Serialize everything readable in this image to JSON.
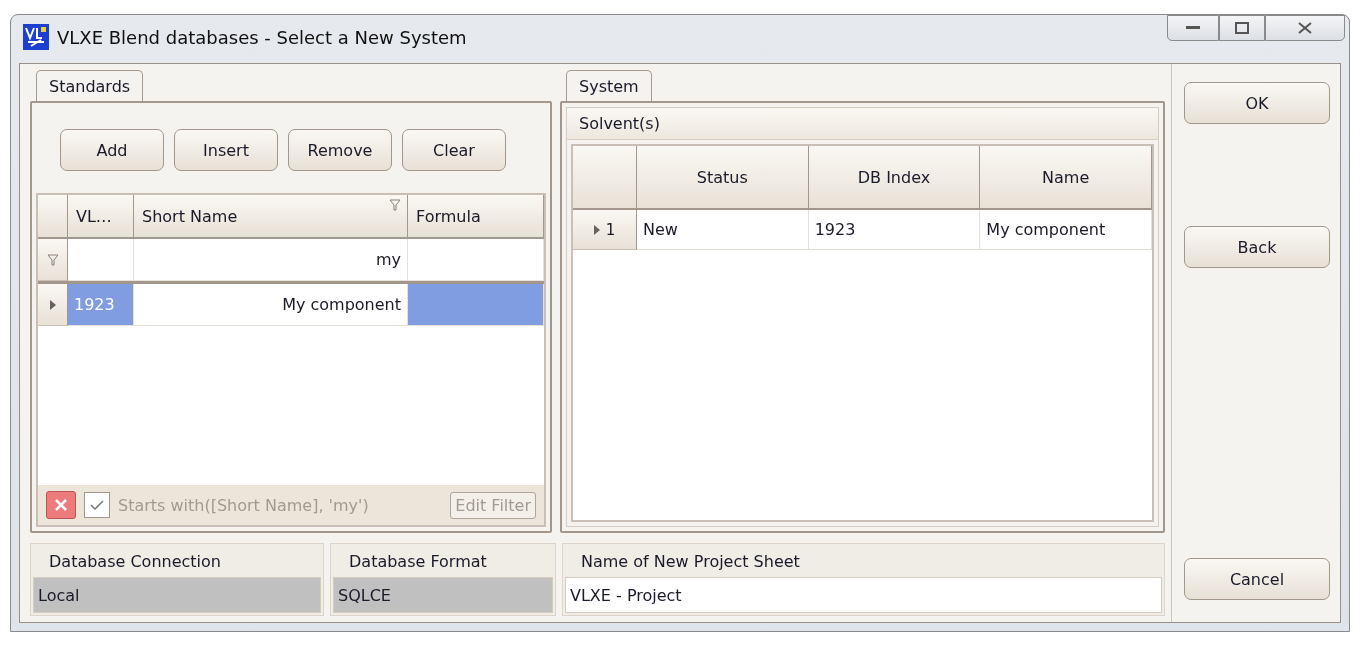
{
  "window": {
    "title": "VLXE Blend databases - Select a New System"
  },
  "standards": {
    "tab": {
      "label": "Standards",
      "selected": true
    },
    "buttons": [
      "Add",
      "Insert",
      "Remove",
      "Clear"
    ],
    "columns": [
      {
        "label": "VL…",
        "filtered": false,
        "focused": false
      },
      {
        "label": "Short Name",
        "filtered": true,
        "focused": true,
        "filter": "my"
      },
      {
        "label": "Formula",
        "filtered": false,
        "focused": false
      }
    ],
    "rows": [
      {
        "selected": true,
        "cells": [
          "1923",
          "My component"
        ]
      }
    ],
    "filter_bar": {
      "enabled": true,
      "text": "Starts with([Short Name], 'my')",
      "button": {
        "label": "Edit Filter",
        "disabled": true
      }
    }
  },
  "system": {
    "tab": {
      "label": "System",
      "selected": true
    },
    "group": "Solvent(s)",
    "columns": [
      "Status",
      "DB Index",
      "Name"
    ],
    "rows": [
      {
        "number": "1",
        "current": true,
        "cells": [
          "New",
          "1923",
          "My component"
        ]
      }
    ]
  },
  "fields": [
    {
      "label": "Database Connection",
      "value": "Local",
      "readonly": true
    },
    {
      "label": "Database Format",
      "value": "SQLCE",
      "readonly": true
    },
    {
      "label": "Name of New Project Sheet",
      "value": "VLXE - Project",
      "readonly": false
    }
  ],
  "side_buttons": [
    "OK",
    "Back",
    "Cancel"
  ]
}
